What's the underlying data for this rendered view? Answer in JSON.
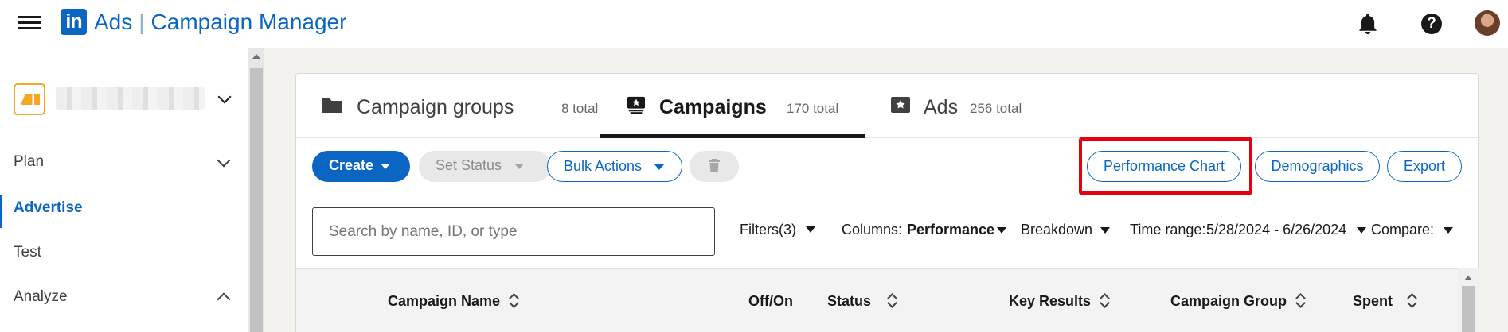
{
  "header": {
    "logo_text": "in",
    "product": "Ads",
    "app_name": "Campaign Manager"
  },
  "sidebar": {
    "nav": [
      {
        "label": "Plan",
        "expanded": false
      },
      {
        "label": "Advertise",
        "active": true
      },
      {
        "label": "Test"
      },
      {
        "label": "Analyze",
        "expanded": true
      }
    ]
  },
  "tabs": [
    {
      "label": "Campaign groups",
      "count": "8 total",
      "icon": "folder-icon"
    },
    {
      "label": "Campaigns",
      "count": "170 total",
      "icon": "campaign-icon",
      "active": true
    },
    {
      "label": "Ads",
      "count": "256 total",
      "icon": "ad-icon"
    }
  ],
  "toolbar": {
    "create_label": "Create",
    "set_status_label": "Set Status",
    "bulk_actions_label": "Bulk Actions",
    "performance_chart_label": "Performance Chart",
    "demographics_label": "Demographics",
    "export_label": "Export"
  },
  "filters": {
    "search_placeholder": "Search by name, ID, or type",
    "filters_label": "Filters(3)",
    "columns_label": "Columns:",
    "columns_value": "Performance",
    "breakdown_label": "Breakdown",
    "time_range_label": "Time range:",
    "time_range_value": "5/28/2024 - 6/26/2024",
    "compare_label": "Compare:"
  },
  "table": {
    "columns": [
      "Campaign Name",
      "Off/On",
      "Status",
      "Key Results",
      "Campaign Group",
      "Spent"
    ]
  },
  "colors": {
    "brand_blue": "#0a66c2",
    "highlight_red": "#e4000f"
  }
}
